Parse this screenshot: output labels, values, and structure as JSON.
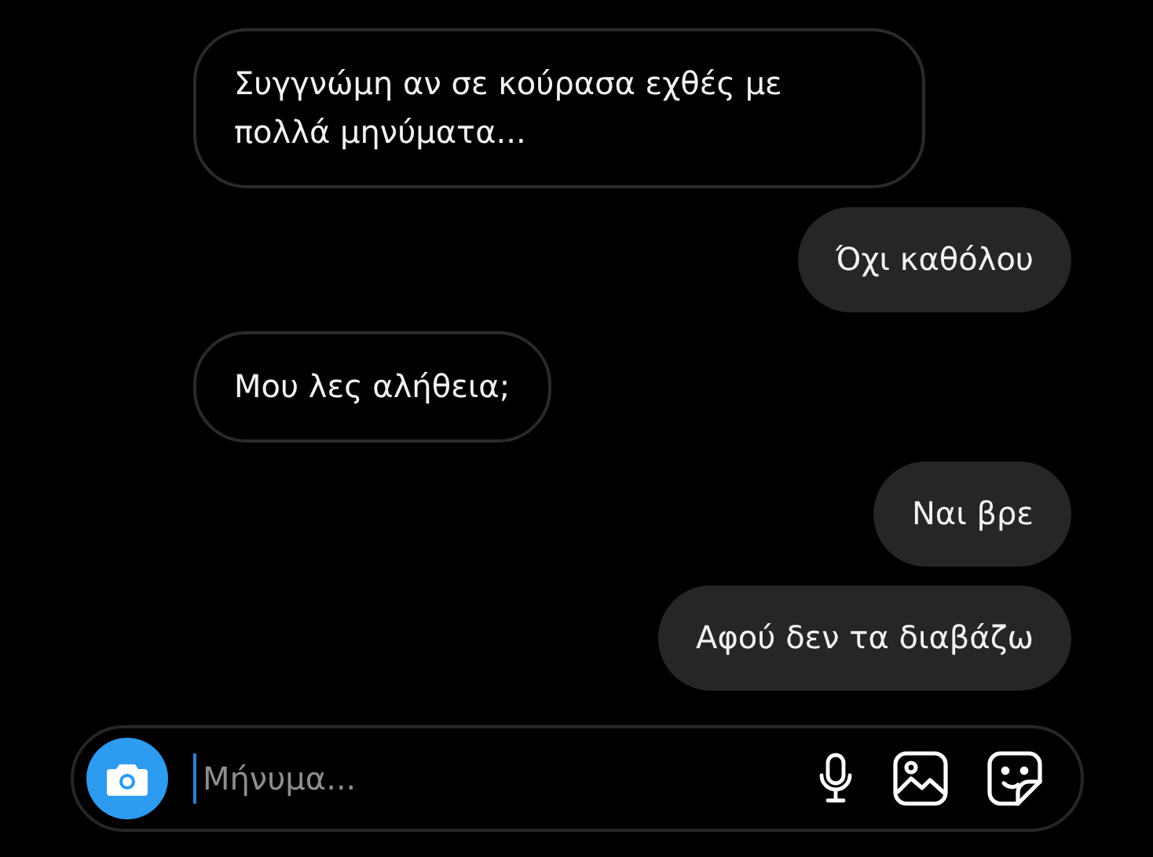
{
  "messages": [
    {
      "kind": "received",
      "text": "Συγγνώμη αν σε κούρασα εχθές με πολλά μηνύματα..."
    },
    {
      "kind": "sent",
      "text": "Όχι καθόλου"
    },
    {
      "kind": "received",
      "text": "Μου λες αλήθεια;"
    },
    {
      "kind": "sent",
      "text": "Ναι βρε"
    },
    {
      "kind": "sent",
      "text": "Αφού δεν τα διαβάζω"
    }
  ],
  "composer": {
    "placeholder": "Μήνυμα..."
  }
}
